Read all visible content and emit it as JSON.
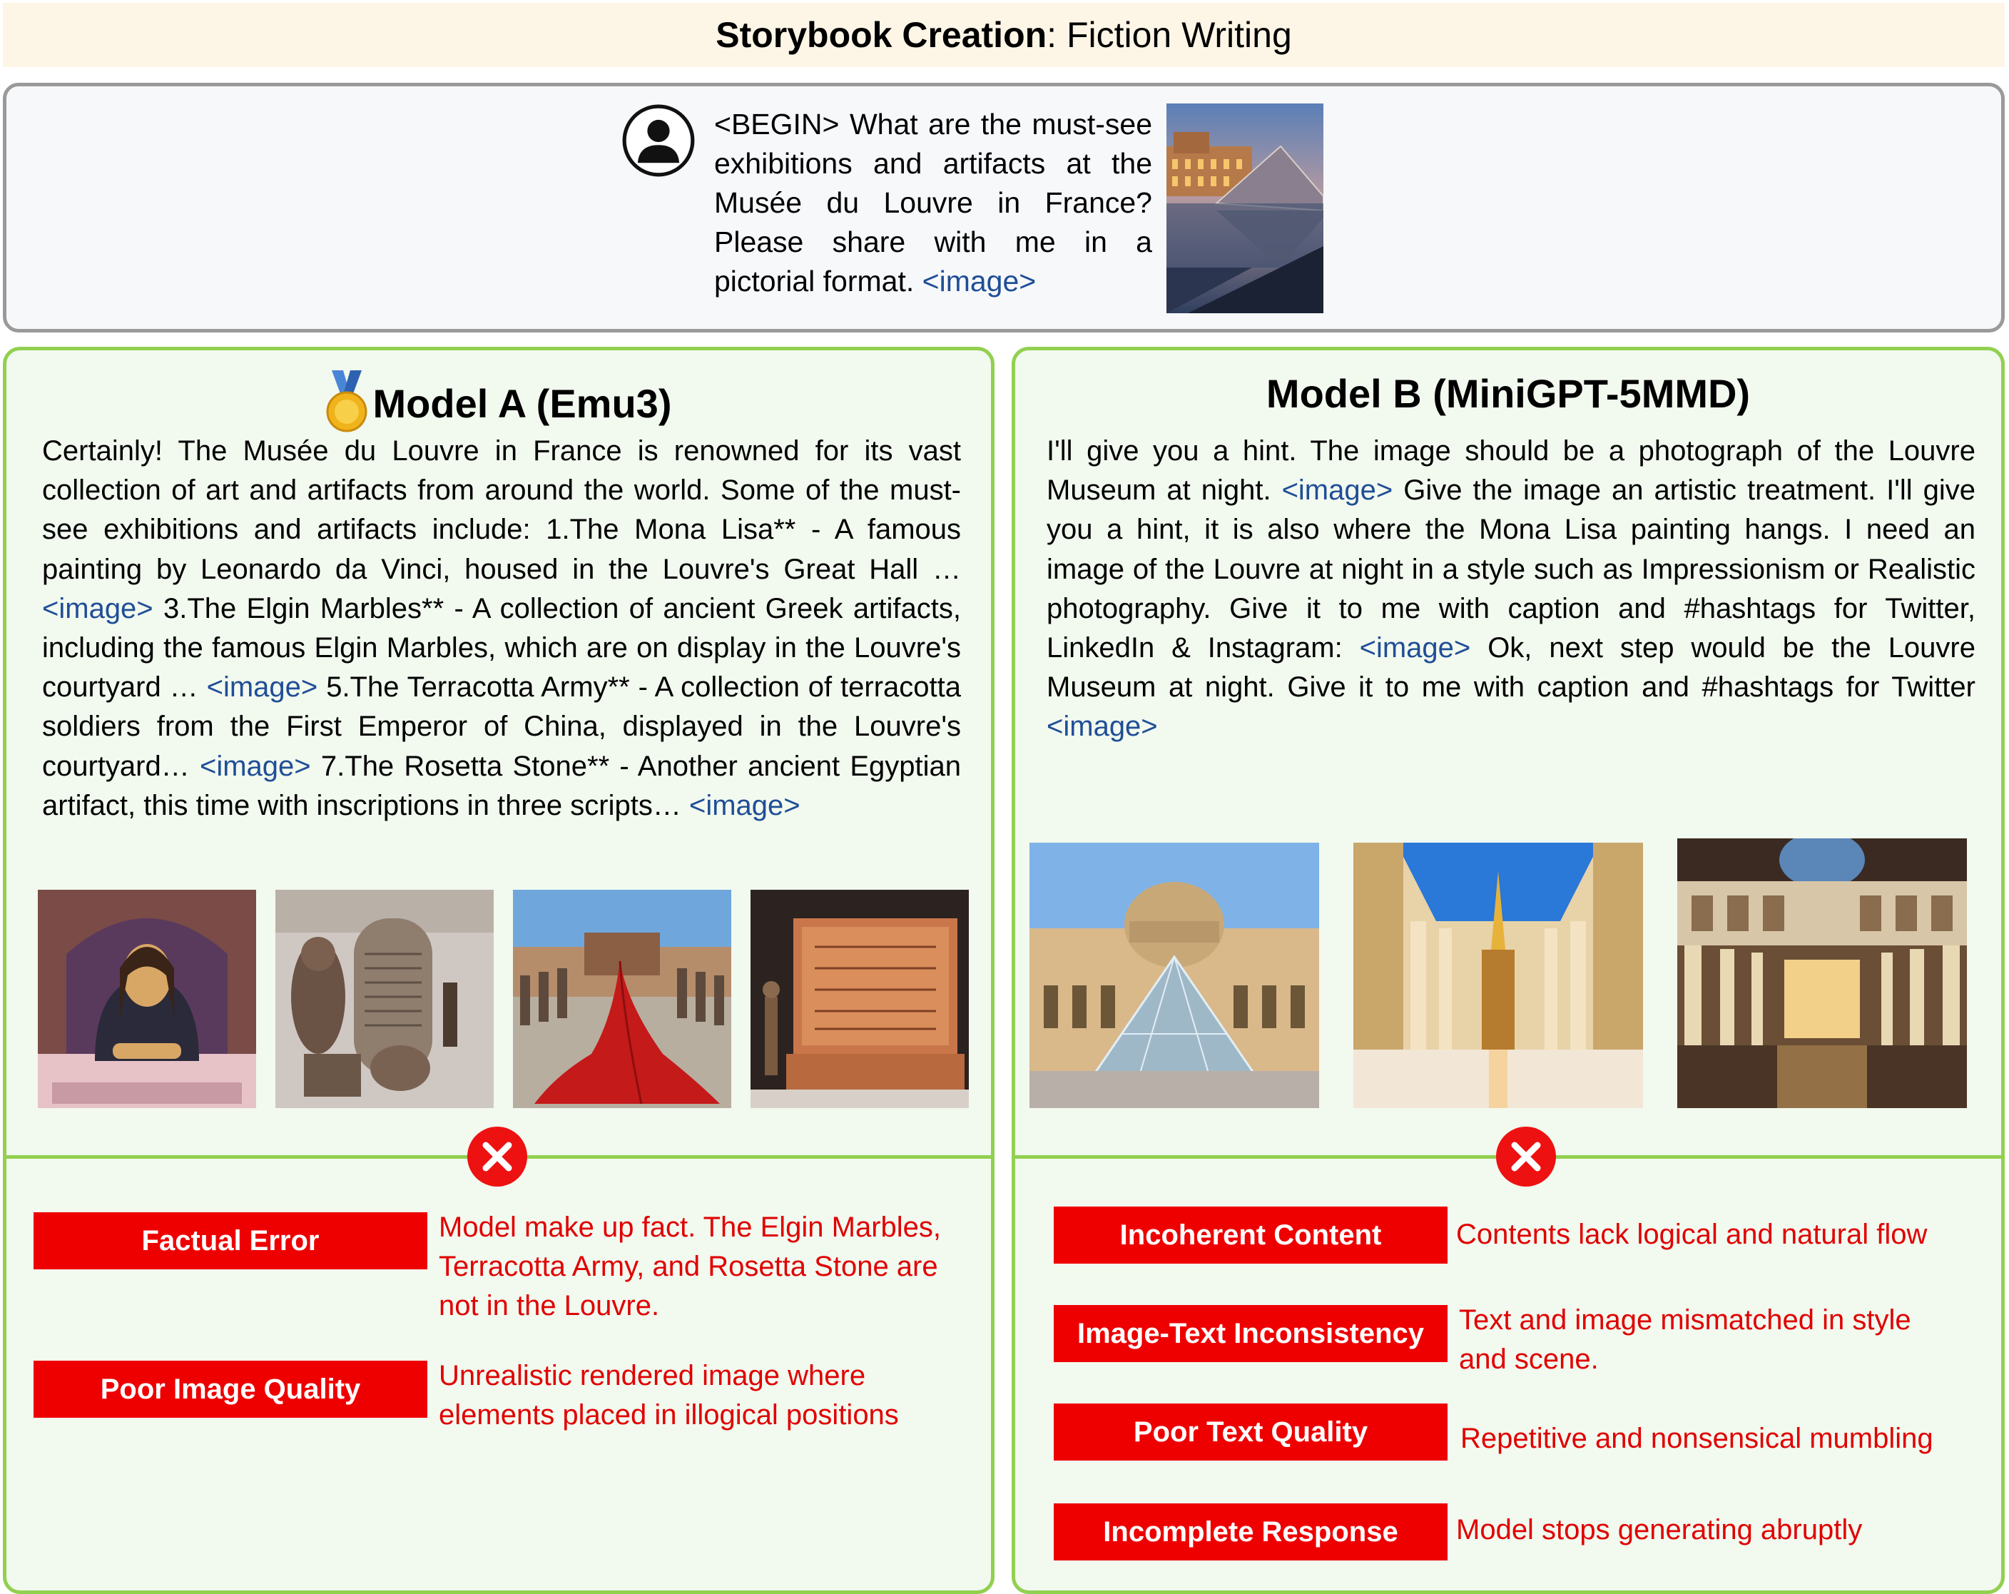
{
  "header": {
    "title_bold": "Storybook Creation",
    "title_rest": ": Fiction Writing"
  },
  "prompt": {
    "text": "<BEGIN> What are the must-see exhibitions and artifacts at the Musée du Louvre in France? Please share with me in a pictorial format.",
    "image_tag": "<image>",
    "photo_subject": "Louvre pyramid at dusk"
  },
  "model_a": {
    "title": "Model A (Emu3)",
    "winner_icon": "gold-medal-icon",
    "response_segments": [
      {
        "text": "Certainly! The Musée du Louvre in France is renowned for its vast collection of art and artifacts from around the world. Some of the must-see exhibitions and artifacts include: 1.The Mona Lisa** - A famous painting by Leonardo da Vinci, housed in the Louvre's Great Hall … ",
        "tag": false
      },
      {
        "text": "<image>",
        "tag": true
      },
      {
        "text": " 3.The Elgin Marbles** - A collection of ancient Greek artifacts, including the famous Elgin Marbles, which are on display in the Louvre's courtyard … ",
        "tag": false
      },
      {
        "text": "<image>",
        "tag": true
      },
      {
        "text": " 5.The Terracotta Army** - A collection of terracotta soldiers from the First Emperor of China, displayed in the Louvre's courtyard… ",
        "tag": false
      },
      {
        "text": "<image>",
        "tag": true
      },
      {
        "text": " 7.The Rosetta Stone** - Another ancient Egyptian artifact, this time with inscriptions in three scripts… ",
        "tag": false
      },
      {
        "text": "<image>",
        "tag": true
      }
    ],
    "images": [
      "Mona Lisa rendering",
      "Stone tablet gallery",
      "Terracotta hall with red cloth",
      "Carved stone relief"
    ],
    "issues": [
      {
        "label": "Factual Error",
        "description": "Model make up fact. The Elgin Marbles, Terracotta Army, and Rosetta Stone are not in the Louvre."
      },
      {
        "label": "Poor Image Quality",
        "description": "Unrealistic rendered image where elements placed in illogical positions"
      }
    ]
  },
  "model_b": {
    "title": "Model B (MiniGPT-5MMD)",
    "response_segments": [
      {
        "text": "I'll give you a hint. The image should be a photograph of the Louvre Museum at night. ",
        "tag": false
      },
      {
        "text": "<image>",
        "tag": true
      },
      {
        "text": " Give the image an artistic treatment. I'll give you a hint, it is also where the Mona Lisa painting hangs. I need an image of the Louvre at night in a style such as Impressionism or Realistic photography. Give it to me with caption and #hashtags for Twitter, LinkedIn & Instagram: ",
        "tag": false
      },
      {
        "text": "<image>",
        "tag": true
      },
      {
        "text": " Ok, next step would be the Louvre Museum at night. Give it to me with caption and #hashtags for Twitter ",
        "tag": false
      },
      {
        "text": "<image>",
        "tag": true
      }
    ],
    "images": [
      "Louvre facade with pyramid",
      "Gallery with blue glass ceiling",
      "Arcaded hall with dome"
    ],
    "issues": [
      {
        "label": "Incoherent Content",
        "description": "Contents lack logical and natural flow"
      },
      {
        "label": "Image-Text Inconsistency",
        "description": "Text and image mismatched in style and scene."
      },
      {
        "label": "Poor Text Quality",
        "description": "Repetitive and nonsensical mumbling"
      },
      {
        "label": "Incomplete Response",
        "description": "Model stops generating abruptly"
      }
    ]
  },
  "colors": {
    "accent_green": "#92d050",
    "error_red": "#ee0000",
    "tag_blue": "#1f4e96",
    "header_bg": "#fdf6e6"
  }
}
